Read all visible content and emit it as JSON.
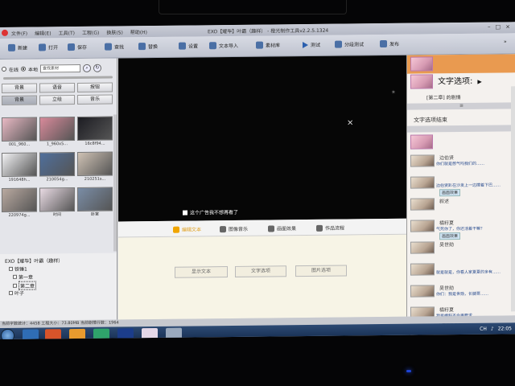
{
  "window": {
    "title": "EXO【耀毕】叶霸（趣样） - 橙光制作工具v2.2.5.1324",
    "menu": [
      "文件(F)",
      "编辑(E)",
      "工具(T)",
      "工程(G)",
      "换肤(S)",
      "帮助(H)"
    ],
    "controls": [
      "–",
      "□",
      "×"
    ]
  },
  "toolbar": {
    "new_label": "新建",
    "open_label": "打开",
    "save_label": "保存",
    "find_label": "查找",
    "replace_label": "替换",
    "settings_label": "设置",
    "text_import_label": "文本导入",
    "library_label": "素材库",
    "test_label": "测试",
    "segment_test_label": "分段测试",
    "publish_label": "发布",
    "chevron": "»"
  },
  "left_panel": {
    "online_label": "在线",
    "local_label": "本地",
    "search_placeholder": "查找素材",
    "search_icon": "search-icon",
    "refresh_icon": "refresh-icon",
    "categories": [
      {
        "label": "背景",
        "selected": false
      },
      {
        "label": "语音",
        "selected": false
      },
      {
        "label": "按钮",
        "selected": false
      },
      {
        "label": "背景",
        "selected": true
      },
      {
        "label": "立绘",
        "selected": false
      },
      {
        "label": "音乐",
        "selected": false
      }
    ],
    "thumbnails": [
      {
        "caption": "001_960...",
        "color": "#e9b9c4"
      },
      {
        "caption": "1_960x5...",
        "color": "#d98a9a"
      },
      {
        "caption": "16c8f94...",
        "color": "#1c1c22"
      },
      {
        "caption": "191648h...",
        "color": "#f2f2f4"
      },
      {
        "caption": "210054g...",
        "color": "#4f6f9c"
      },
      {
        "caption": "210251s...",
        "color": "#cfc2b4"
      },
      {
        "caption": "220974g...",
        "color": "#b9a9a0"
      },
      {
        "caption": "时间",
        "color": "#e9dbe4"
      },
      {
        "caption": "卧室",
        "color": "#7a8da6"
      }
    ]
  },
  "tree": {
    "items": [
      {
        "label": "EXO【耀毕】叶霸（趣样）",
        "indent": 0,
        "selected": false
      },
      {
        "label": "铁锤1",
        "indent": 1,
        "selected": false
      },
      {
        "label": "第一章",
        "indent": 2,
        "selected": false
      },
      {
        "label": "第二章",
        "indent": 2,
        "selected": true
      },
      {
        "label": "叶子",
        "indent": 1,
        "selected": false
      }
    ]
  },
  "video": {
    "no_ad_label": "这个广告我不想再看了",
    "close_glyph": "×"
  },
  "editor_tabs": {
    "tabs": [
      {
        "label": "编辑文本",
        "active": true
      },
      {
        "label": "图像音乐",
        "active": false
      },
      {
        "label": "画面效果",
        "active": false
      },
      {
        "label": "作品流程",
        "active": false
      }
    ],
    "buttons": [
      "显示文本",
      "文字选项",
      "图片选项"
    ]
  },
  "right_panel": {
    "title": "文字选项:",
    "chapter": "[第二章] 的剧情",
    "bar_glyph": "≡",
    "end_label": "文字选项结束",
    "chats": [
      {
        "name": "边伯贤",
        "message": "你们就是憋气吗我们的……",
        "effect": ""
      },
      {
        "name": "",
        "message": "边伯贤趴在沙发上一边撑着下巴……",
        "effect": "画面效果"
      },
      {
        "name": "叙述",
        "message": "",
        "effect": ""
      },
      {
        "name": "橘籽夏",
        "message": "气死你了，你还活着干嘛？",
        "effect": "画面效果"
      },
      {
        "name": "吴世勋",
        "message": "",
        "effect": ""
      },
      {
        "name": "",
        "message": "就是就是，你看人家夏夏的多有……",
        "effect": ""
      },
      {
        "name": "吴世勋",
        "message": "你们：我是世勋，长腿哥……",
        "effect": ""
      },
      {
        "name": "橘籽夏",
        "message": "我是橘籽不会再要求……",
        "effect": "画面效果"
      },
      {
        "name": "吴世勋",
        "message": "",
        "effect": ""
      }
    ]
  },
  "status_bar": {
    "text": "当前字数统计：4458 工程大小：73.80MB 当前剧情行数：1964"
  },
  "taskbar": {
    "tray_lang": "CH",
    "time": "22:05",
    "date": "2015/5/1"
  },
  "colors": {
    "accent_orange": "#f0a500",
    "right_header": "#e99a50",
    "video_bg": "#060606",
    "taskbar": "#1b355c"
  }
}
